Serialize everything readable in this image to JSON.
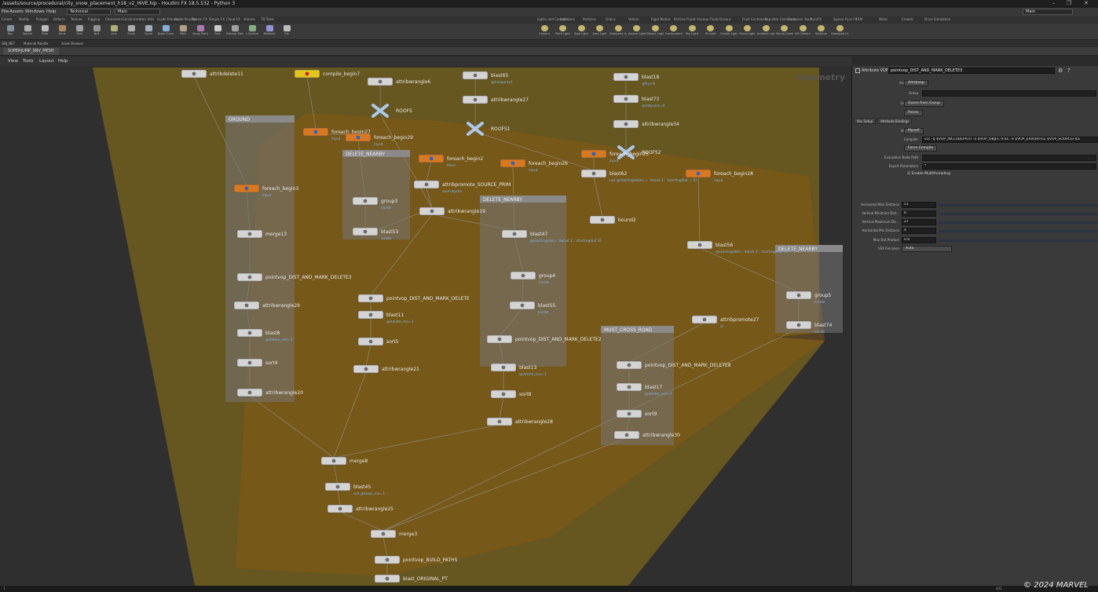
{
  "window": {
    "title": "/assets/source/procedural/city_snow_placement_h18_v2_HIVE.hip - Houdini FX 18.5.532 - Python 3",
    "controls": [
      "–",
      "❐",
      "✕"
    ]
  },
  "menubar": {
    "items": [
      "File",
      "Assets",
      "Windows",
      "Help"
    ],
    "desktop": "Technical",
    "main_label": "Main",
    "right_main": "Main"
  },
  "shelf_tabs_left": [
    "Create",
    "Modify",
    "Polygon",
    "Deform",
    "Texture",
    "Rigging",
    "Characters",
    "Constraints",
    "Hair Utils",
    "Guide Process",
    "Guide Brushes",
    "Terrain FX",
    "Simple FX",
    "Cloud FX",
    "Volume",
    "TD Tools"
  ],
  "shelf_tabs_right": [
    "Lights and Cameras",
    "Collisions",
    "Particles",
    "Grains",
    "Vellum",
    "Rigid Bodies",
    "Particle Fluids",
    "Viscous Fluids",
    "Oceans",
    "Fluid Containers",
    "Populate Containers",
    "Container Tools",
    "PyroFX",
    "Sparse Pyro FX",
    "FEM",
    "Wires",
    "Crowds",
    "Drive Simulation"
  ],
  "shelf_tools_left": [
    "Box",
    "Sphere",
    "Tube",
    "Torus",
    "Grid",
    "Null",
    "Line",
    "Circle",
    "Curve",
    "Draw Curve",
    "Path",
    "Spray Paint",
    "Font",
    "Platonic Solids",
    "L-System",
    "Metaball",
    "File"
  ],
  "shelf_tools_right": [
    "Camera",
    "Point Light",
    "Spot Light",
    "Area Light",
    "Geometry Light",
    "Volume Light",
    "Distant Light",
    "Environment Light",
    "Sky Light",
    "GI Light",
    "Caustic Light",
    "Portal Light",
    "Ambient Light",
    "Stereo Camera",
    "VR Camera",
    "Switcher",
    "Gamepad Camera"
  ],
  "subbar": {
    "items": [
      "OBJ_NET",
      "Material Palette",
      "Asset Browser"
    ]
  },
  "network_tab": "SUPERJUMP_SNV_MESH",
  "network_menu": [
    "View",
    "Tools",
    "Layout",
    "Help"
  ],
  "network_context": "Geometry",
  "boxes": {
    "ground": "GROUND",
    "delete_nearby_a": "DELETE_NEARBY",
    "delete_nearby_b": "DELETE_NEARBY",
    "delete_nearby_c": "DELETE_NEARBY",
    "must_cross": "MUST_CROSS_ROAD"
  },
  "nodes": [
    {
      "name": "attribdelete11",
      "sub": ""
    },
    {
      "name": "compile_begin7",
      "sub": ""
    },
    {
      "name": "attribwrangle6",
      "sub": ""
    },
    {
      "name": "ROOFS",
      "sub": ""
    },
    {
      "name": "blast65",
      "sub": "@hasparent"
    },
    {
      "name": "attribwrangle27",
      "sub": ""
    },
    {
      "name": "ROOFS1",
      "sub": ""
    },
    {
      "name": "blast18",
      "sub": "@P.y<6"
    },
    {
      "name": "blast73",
      "sub": "@fallpoint=0"
    },
    {
      "name": "attribwrangle34",
      "sub": ""
    },
    {
      "name": "ROOFS2",
      "sub": ""
    },
    {
      "name": "foreach_begin27",
      "sub": "input"
    },
    {
      "name": "foreach_begin29",
      "sub": "input"
    },
    {
      "name": "foreach_begin2",
      "sub": "Point"
    },
    {
      "name": "foreach_begin26",
      "sub": "input"
    },
    {
      "name": "foreach_begin25",
      "sub": "input"
    },
    {
      "name": "foreach_begin28",
      "sub": "input"
    },
    {
      "name": "foreach_begin3",
      "sub": "input"
    },
    {
      "name": "attribpromote_SOURCE_PRIM",
      "sub": "sourceprim"
    },
    {
      "name": "blast62",
      "sub": "not @startinglatten = 'detail:1', 'startingdist = 0)"
    },
    {
      "name": "group3",
      "sub": "inside"
    },
    {
      "name": "blast53",
      "sub": "inside"
    },
    {
      "name": "attribwrangle19",
      "sub": ""
    },
    {
      "name": "merge13",
      "sub": ""
    },
    {
      "name": "bound2",
      "sub": ""
    },
    {
      "name": "blast56",
      "sub": "@startingdist= 'detail:1', 'startingdist' 0)"
    },
    {
      "name": "blast47",
      "sub": "@startingdist= 'detail:1', 'startingdist 0)"
    },
    {
      "name": "pointvop_DIST_AND_MARK_DELETE3",
      "sub": ""
    },
    {
      "name": "group4",
      "sub": "inside"
    },
    {
      "name": "pointvop_DIST_AND_MARK_DELETE",
      "sub": ""
    },
    {
      "name": "group5",
      "sub": "inside"
    },
    {
      "name": "attribwrangle29",
      "sub": ""
    },
    {
      "name": "blast55",
      "sub": "inside"
    },
    {
      "name": "blast11",
      "sub": "@delete_me=1"
    },
    {
      "name": "blast74",
      "sub": "inside"
    },
    {
      "name": "attribpromote27",
      "sub": "id"
    },
    {
      "name": "blast8",
      "sub": "@delete_me=1"
    },
    {
      "name": "pointvop_DIST_AND_MARK_DELETE2",
      "sub": ""
    },
    {
      "name": "sort5",
      "sub": ""
    },
    {
      "name": "sort4",
      "sub": ""
    },
    {
      "name": "pointvop_DIST_AND_MARK_DELETE8",
      "sub": ""
    },
    {
      "name": "attribwrangle21",
      "sub": ""
    },
    {
      "name": "blast13",
      "sub": "@delete_me=1"
    },
    {
      "name": "blast17",
      "sub": "@delete_me=1"
    },
    {
      "name": "attribwrangle20",
      "sub": ""
    },
    {
      "name": "sort8",
      "sub": ""
    },
    {
      "name": "sort9",
      "sub": ""
    },
    {
      "name": "attribwrangle28",
      "sub": ""
    },
    {
      "name": "attribwrangle30",
      "sub": ""
    },
    {
      "name": "merge8",
      "sub": ""
    },
    {
      "name": "blast45",
      "sub": "not @keep_me=1"
    },
    {
      "name": "attribwrangle25",
      "sub": ""
    },
    {
      "name": "merge3",
      "sub": ""
    },
    {
      "name": "pointvop_BUILD_PATHS",
      "sub": ""
    },
    {
      "name": "blast_ORIGINAL_PT",
      "sub": ""
    }
  ],
  "params": {
    "type_label": "Attribute VOP",
    "node_name": "pointvop_DIST_AND_MARK_DELETE3",
    "rows": [
      {
        "label": "Asset Name",
        "value": "Attribvop",
        "kind": "btn"
      },
      {
        "label": "Group",
        "value": "",
        "kind": "field"
      },
      {
        "label": "Group Type",
        "value": "Guess from Group",
        "kind": "btn"
      },
      {
        "label": "Run Over",
        "value": "Points",
        "kind": "btn"
      }
    ],
    "tabs": [
      "Vex Setup",
      "Attribute Bindings"
    ],
    "vex_rows": [
      {
        "label": "Vex Source",
        "value": "Myself",
        "kind": "btn"
      },
      {
        "label": "Compiler",
        "value": "vcc -q $VOP_INCLUDEPATH -o $VOP_OBJECTFILE -e $VOP_ERRORFILE $VOP_SOURCEFILE",
        "kind": "field"
      },
      {
        "label": "",
        "value": "Force Compile",
        "kind": "btn"
      },
      {
        "label": "Evaluation Node Path",
        "value": "",
        "kind": "field"
      },
      {
        "label": "Export Parameters",
        "value": "*",
        "kind": "field"
      },
      {
        "label": "",
        "value": "Enable Multithreading",
        "kind": "check"
      }
    ],
    "sliders": [
      {
        "label": "Horizontal Max Distance",
        "value": "51"
      },
      {
        "label": "Vertical Minimum Dist...",
        "value": "6"
      },
      {
        "label": "Vertical Maximum Dis...",
        "value": "27"
      },
      {
        "label": "Horizontal Min Distance",
        "value": "4"
      },
      {
        "label": "Max Dot Product",
        "value": "0.9"
      }
    ],
    "vex_precision": {
      "label": "VEX Precision",
      "value": "Auto"
    }
  },
  "statusbar": {
    "left": "Geometry",
    "frame": "1",
    "right": "441"
  },
  "watermark": "© 2024 MARVEL"
}
